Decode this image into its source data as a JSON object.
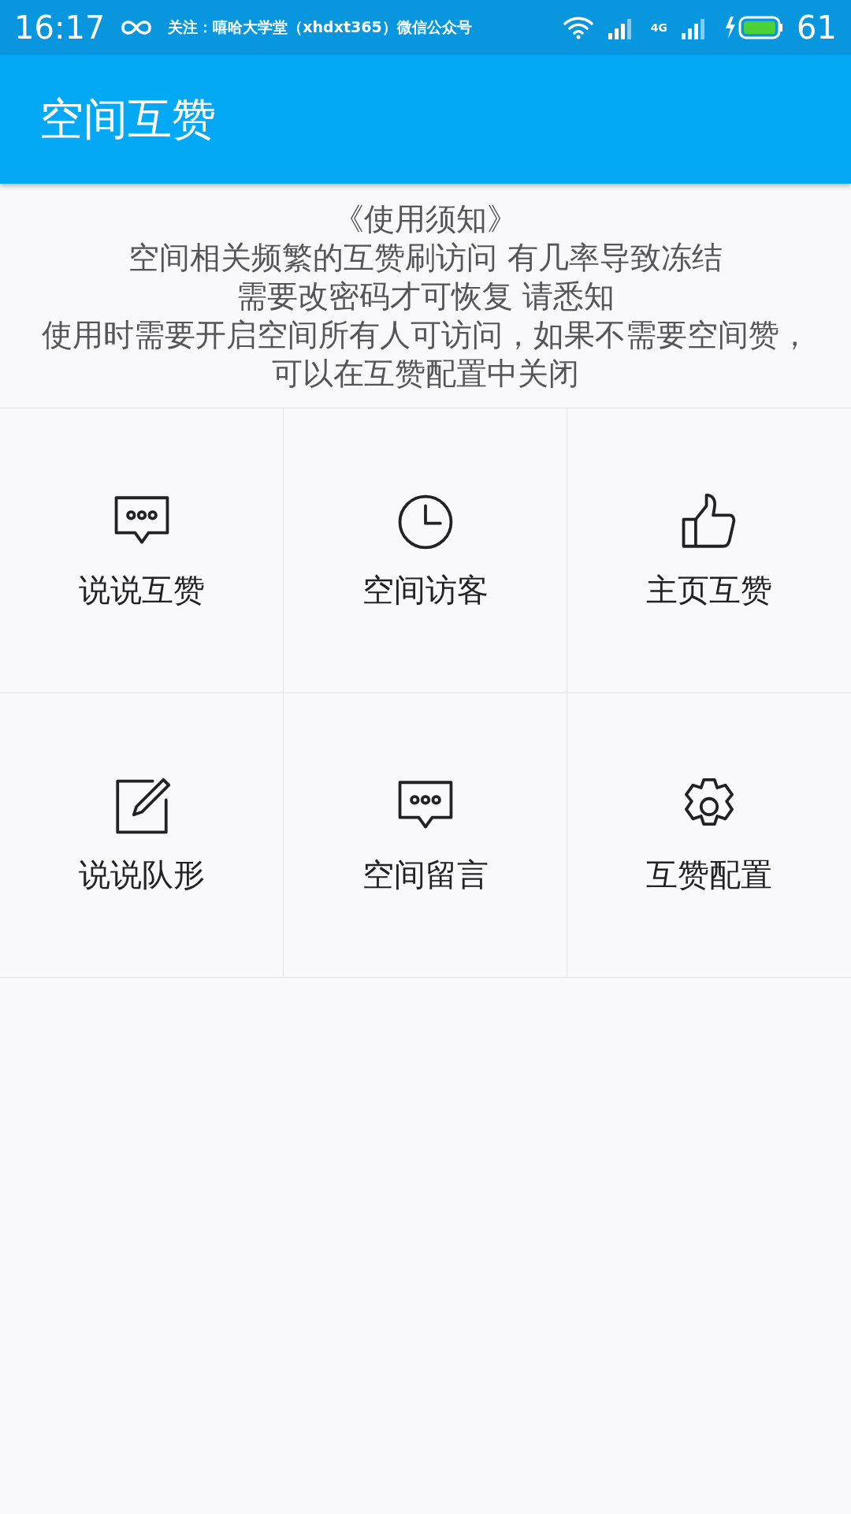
{
  "status_bar": {
    "time": "16:17",
    "notification": "关注：嘻哈大学堂（xhdxt365）微信公众号",
    "network": "4G",
    "battery": "61"
  },
  "app_bar": {
    "title": "空间互赞"
  },
  "notice": {
    "lines": [
      "《使用须知》",
      "空间相关频繁的互赞刷访问 有几率导致冻结",
      "需要改密码才可恢复 请悉知",
      "使用时需要开启空间所有人可访问，如果不需要空间赞，",
      "可以在互赞配置中关闭"
    ]
  },
  "menu": [
    {
      "label": "说说互赞",
      "kind": "chat"
    },
    {
      "label": "空间访客",
      "kind": "clock"
    },
    {
      "label": "主页互赞",
      "kind": "thumb"
    },
    {
      "label": "说说队形",
      "kind": "edit"
    },
    {
      "label": "空间留言",
      "kind": "chat"
    },
    {
      "label": "互赞配置",
      "kind": "gear"
    }
  ]
}
